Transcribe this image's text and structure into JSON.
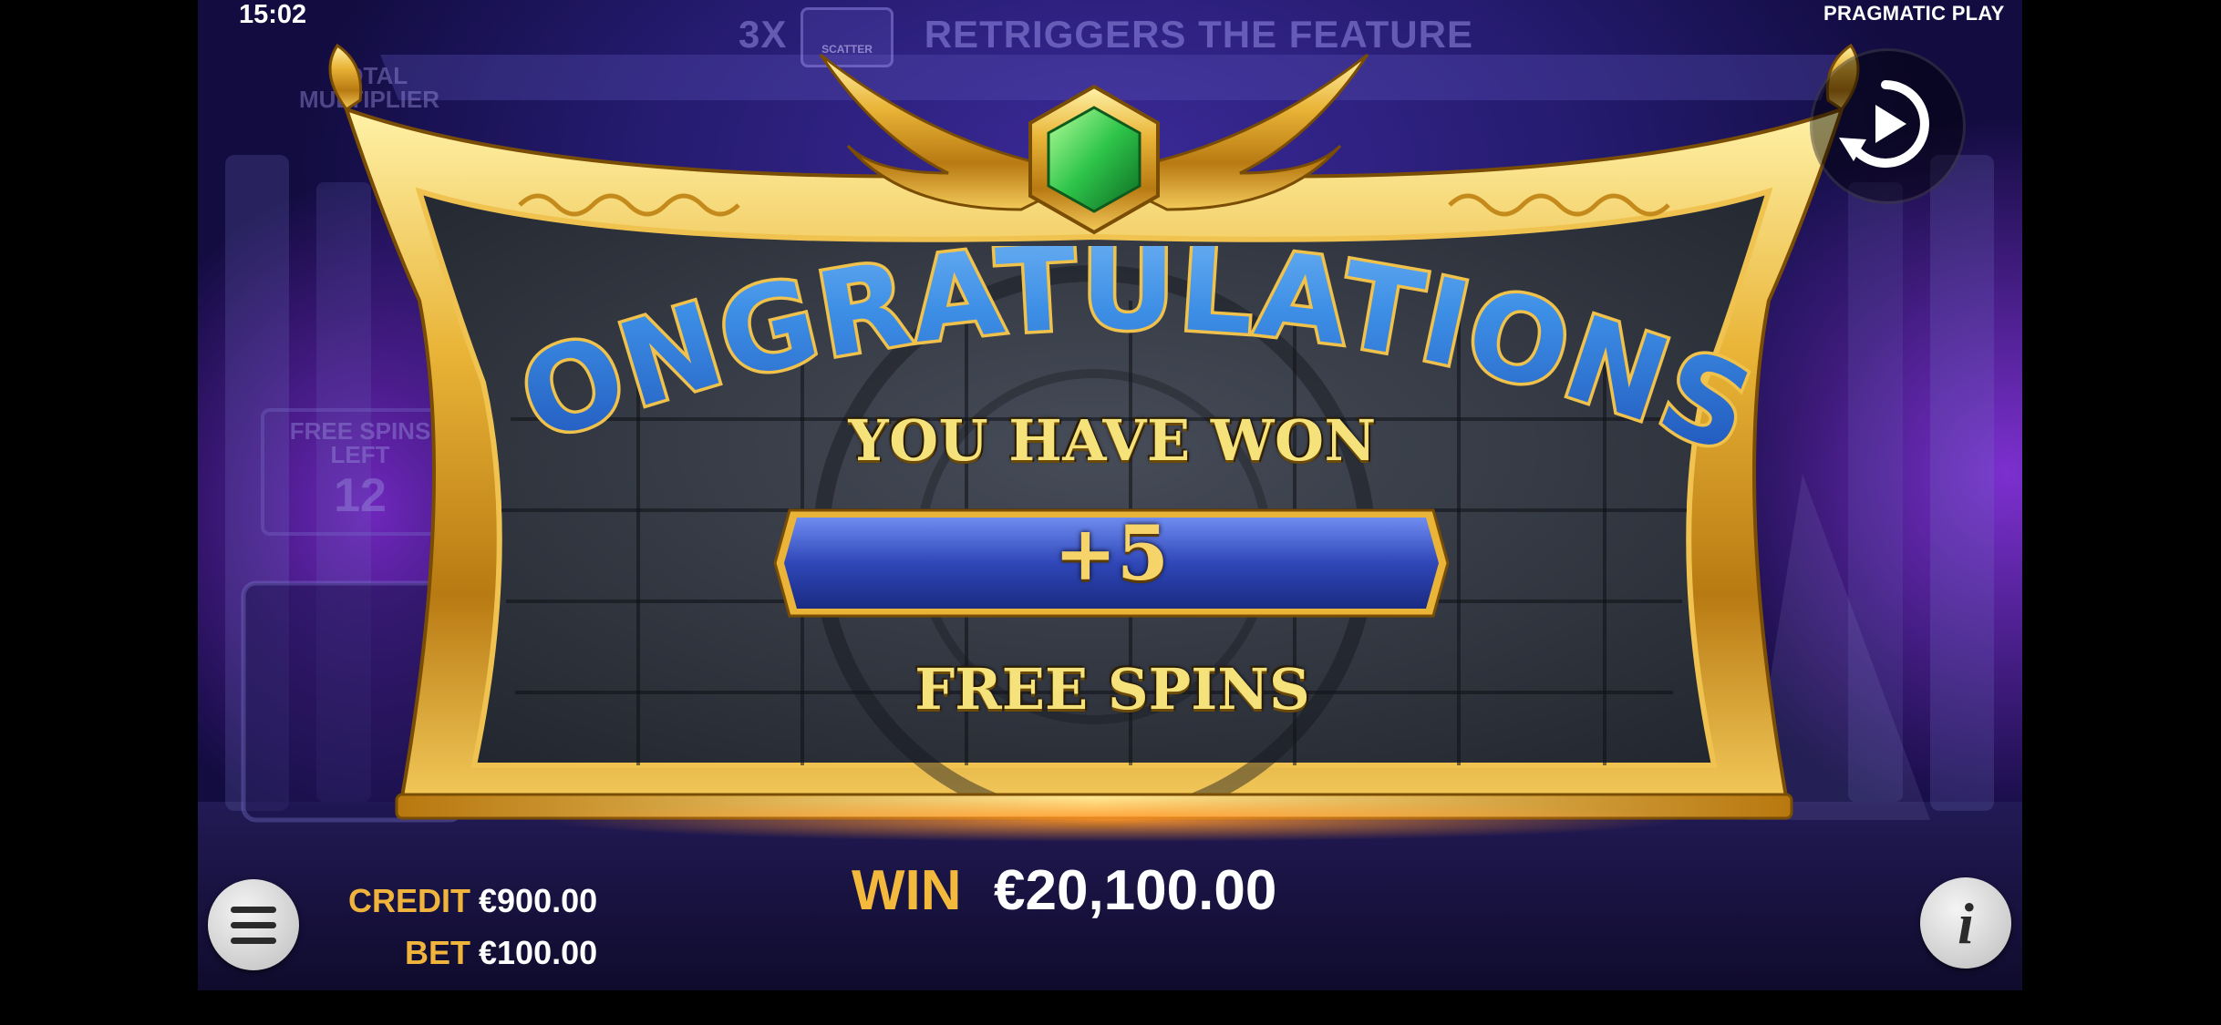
{
  "status_bar": {
    "time": "15:02"
  },
  "provider": "PRAGMATIC PLAY",
  "background": {
    "banner_prefix": "3X",
    "banner_icon_label": "SCATTER",
    "banner_text": "RETRIGGERS THE FEATURE",
    "total_multiplier_label": "TOTAL MULTIPLIER",
    "free_spins_left_label": "FREE SPINS LEFT",
    "free_spins_left_value": "12"
  },
  "popup": {
    "headline": "CONGRATULATIONS!",
    "subtitle": "YOU HAVE WON",
    "award": "+5",
    "award_caption": "FREE SPINS"
  },
  "footer": {
    "credit_label": "CREDIT",
    "credit_value": "€900.00",
    "bet_label": "BET",
    "bet_value": "€100.00",
    "win_label": "WIN",
    "win_value": "€20,100.00"
  },
  "colors": {
    "gold": "#f2b93c",
    "blue_letters": "#3d8fe6",
    "background_purple": "#5a2bb8",
    "gem_green": "#39c94a"
  },
  "icons": [
    "replay-icon",
    "menu-icon",
    "info-icon",
    "emerald-gem-icon"
  ]
}
